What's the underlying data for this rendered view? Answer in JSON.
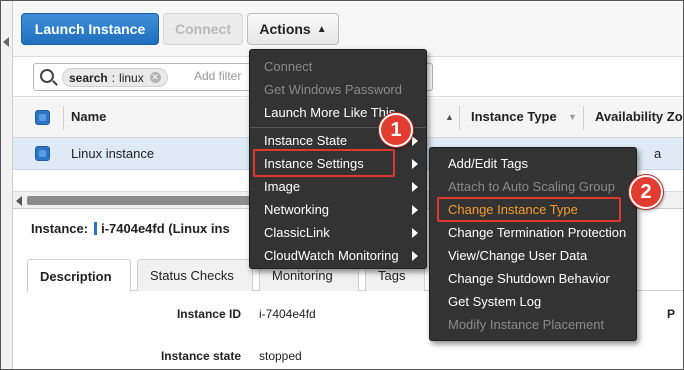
{
  "toolbar": {
    "launch_label": "Launch Instance",
    "connect_label": "Connect",
    "actions_label": "Actions"
  },
  "search": {
    "token_key": "search",
    "token_sep": ":",
    "token_value": "linux",
    "placeholder": "Add filter"
  },
  "table": {
    "headers": [
      "Name",
      "Instance Type",
      "Availability Zo"
    ],
    "row": {
      "name": "Linux instance",
      "az_partial": "a"
    }
  },
  "details": {
    "instance_label": "Instance:",
    "instance_value": "i-7404e4fd (Linux ins",
    "tabs": [
      "Description",
      "Status Checks",
      "Monitoring",
      "Tags"
    ],
    "fields": [
      {
        "label": "Instance ID",
        "value": "i-7404e4fd"
      },
      {
        "label": "Instance state",
        "value": "stopped"
      }
    ],
    "right_partial": "P"
  },
  "actions_menu": {
    "items": [
      {
        "label": "Connect",
        "disabled": true
      },
      {
        "label": "Get Windows Password",
        "disabled": true
      },
      {
        "label": "Launch More Like This",
        "disabled": false
      },
      {
        "label": "Instance State",
        "disabled": false,
        "submenu": true
      },
      {
        "label": "Instance Settings",
        "disabled": false,
        "submenu": true,
        "highlighted": true
      },
      {
        "label": "Image",
        "disabled": false,
        "submenu": true
      },
      {
        "label": "Networking",
        "disabled": false,
        "submenu": true
      },
      {
        "label": "ClassicLink",
        "disabled": false,
        "submenu": true
      },
      {
        "label": "CloudWatch Monitoring",
        "disabled": false,
        "submenu": true
      }
    ]
  },
  "settings_submenu": {
    "items": [
      {
        "label": "Add/Edit Tags",
        "disabled": false
      },
      {
        "label": "Attach to Auto Scaling Group",
        "disabled": true
      },
      {
        "label": "Change Instance Type",
        "disabled": false,
        "highlighted": true
      },
      {
        "label": "Change Termination Protection",
        "disabled": false
      },
      {
        "label": "View/Change User Data",
        "disabled": false
      },
      {
        "label": "Change Shutdown Behavior",
        "disabled": false
      },
      {
        "label": "Get System Log",
        "disabled": false
      },
      {
        "label": "Modify Instance Placement",
        "disabled": true
      }
    ]
  },
  "callouts": {
    "step1": "1",
    "step2": "2"
  },
  "colors": {
    "primary": "#2a7ccb",
    "menu_bg": "#333333",
    "highlight_orange": "#f39c2b",
    "callout_red": "#e23b30"
  }
}
